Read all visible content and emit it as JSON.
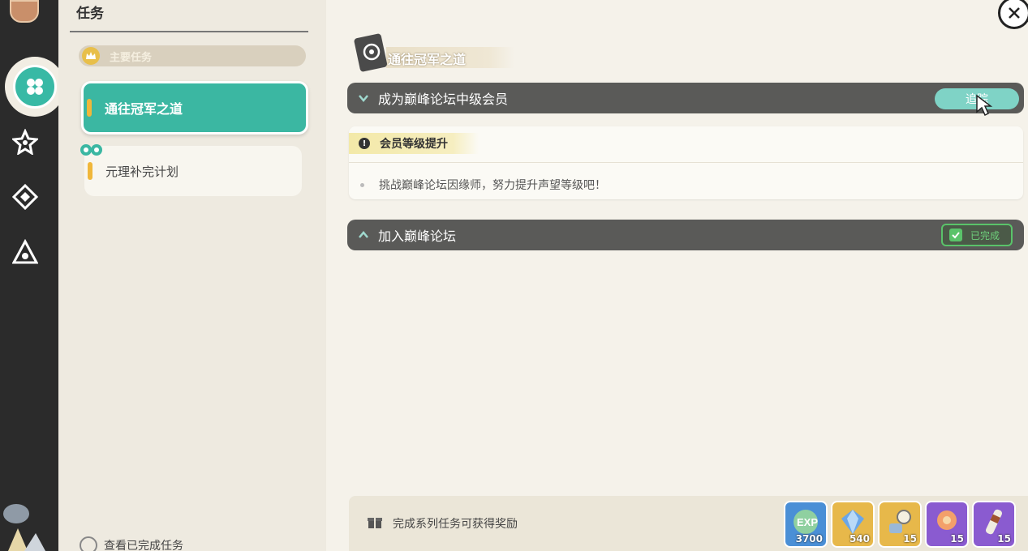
{
  "list_panel": {
    "title": "任务",
    "category_label": "主要任务",
    "quests": [
      {
        "label": "通往冠军之道",
        "active": true
      },
      {
        "label": "元理补完计划",
        "active": false
      }
    ],
    "view_completed_label": "查看已完成任务"
  },
  "main": {
    "chapter_title": "通往冠军之道",
    "goals": [
      {
        "title": "成为巅峰论坛中级会员",
        "expanded": true,
        "action_label": "追踪",
        "detail_heading": "会员等级提升",
        "detail_text": "挑战巅峰论坛因缘师，努力提升声望等级吧！"
      },
      {
        "title": "加入巅峰论坛",
        "expanded": false,
        "status_label": "已完成"
      }
    ],
    "rewards": {
      "label": "完成系列任务可获得奖励",
      "items": [
        {
          "icon": "exp-icon",
          "qty": "3700",
          "color": "#4a8fd6"
        },
        {
          "icon": "gem-icon",
          "qty": "540",
          "color": "#e7b84a"
        },
        {
          "icon": "key-item-icon",
          "qty": "15",
          "color": "#e7b84a"
        },
        {
          "icon": "flower-icon",
          "qty": "15",
          "color": "#8a5bd0"
        },
        {
          "icon": "scroll-icon",
          "qty": "15",
          "color": "#8a5bd0"
        }
      ]
    }
  },
  "colors": {
    "accent": "#3bb7a2",
    "rail": "#2b2b2b",
    "goal_bar": "#5a5a58",
    "complete": "#5ac36a"
  }
}
